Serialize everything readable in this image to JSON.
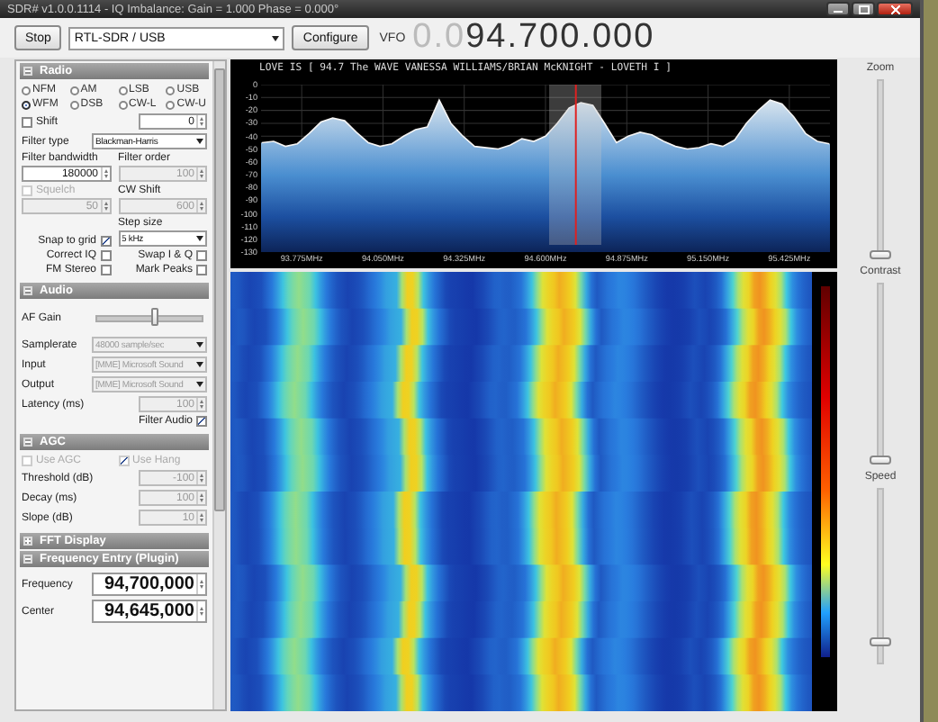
{
  "window": {
    "title": "SDR# v1.0.0.1114 - IQ Imbalance: Gain = 1.000 Phase = 0.000°"
  },
  "toolbar": {
    "stop_button": "Stop",
    "device": "RTL-SDR / USB",
    "configure_button": "Configure",
    "vfo_label": "VFO",
    "frequency_dim": "0.0",
    "frequency": "94.700.000"
  },
  "sidebar": {
    "sections": [
      {
        "title": "Radio",
        "expanded": true,
        "rows": [
          {
            "kind": "grid",
            "cells": [
              {
                "kind": "radio",
                "label": "NFM",
                "selected": false
              },
              {
                "kind": "radio",
                "label": "AM",
                "selected": false
              },
              {
                "kind": "radio",
                "label": "LSB",
                "selected": false
              },
              {
                "kind": "radio",
                "label": "USB",
                "selected": false
              }
            ]
          },
          {
            "kind": "grid",
            "cells": [
              {
                "kind": "radio",
                "label": "WFM",
                "selected": true
              },
              {
                "kind": "radio",
                "label": "DSB",
                "selected": false
              },
              {
                "kind": "radio",
                "label": "CW-L",
                "selected": false
              },
              {
                "kind": "radio",
                "label": "CW-U",
                "selected": false
              }
            ]
          },
          {
            "kind": "pair",
            "cells": [
              {
                "kind": "check",
                "label": "Shift",
                "checked": false,
                "disabled": false
              },
              {
                "kind": "spin",
                "value": "0",
                "disabled": false
              }
            ]
          },
          {
            "kind": "pair",
            "cells": [
              {
                "kind": "label",
                "text": "Filter type"
              },
              {
                "kind": "select",
                "value": "Blackman-Harris",
                "disabled": false
              }
            ]
          },
          {
            "kind": "grid",
            "cells": [
              {
                "kind": "spin",
                "value": "180000",
                "disabled": false,
                "over": {
                  "kind": "label",
                  "text": "Filter bandwidth"
                }
              },
              {
                "kind": "spin",
                "value": "100",
                "disabled": true,
                "over": {
                  "kind": "label",
                  "text": "Filter order"
                }
              }
            ]
          },
          {
            "kind": "grid",
            "cells": [
              {
                "kind": "spin",
                "value": "50",
                "disabled": true,
                "over": {
                  "kind": "check",
                  "label": "Squelch",
                  "checked": false,
                  "disabled": true
                }
              },
              {
                "kind": "spin",
                "value": "600",
                "disabled": true,
                "over": {
                  "kind": "label",
                  "text": "CW Shift"
                }
              }
            ]
          },
          {
            "kind": "grid",
            "cells": [
              {
                "kind": "labelled-check",
                "label": "Snap to grid",
                "checked": true,
                "disabled": false
              },
              {
                "kind": "select",
                "value": "5 kHz",
                "disabled": false,
                "over": {
                  "kind": "label",
                  "text": "Step size"
                }
              }
            ]
          },
          {
            "kind": "grid",
            "cells": [
              {
                "kind": "labelled-check",
                "label": "Correct IQ",
                "checked": false,
                "disabled": false
              },
              {
                "kind": "labelled-check",
                "label": "Swap I & Q",
                "checked": false,
                "disabled": false
              }
            ]
          },
          {
            "kind": "grid",
            "cells": [
              {
                "kind": "labelled-check",
                "label": "FM Stereo",
                "checked": false,
                "disabled": false
              },
              {
                "kind": "labelled-check",
                "label": "Mark Peaks",
                "checked": false,
                "disabled": false
              }
            ]
          }
        ]
      },
      {
        "title": "Audio",
        "expanded": true,
        "rows": [
          {
            "kind": "pair",
            "cells": [
              {
                "kind": "label",
                "text": "AF Gain"
              },
              {
                "kind": "slider",
                "level": 0.55
              }
            ]
          },
          {
            "kind": "pair",
            "cells": [
              {
                "kind": "label",
                "text": "Samplerate"
              },
              {
                "kind": "select",
                "value": "48000 sample/sec",
                "disabled": true
              }
            ]
          },
          {
            "kind": "pair",
            "cells": [
              {
                "kind": "label",
                "text": "Input"
              },
              {
                "kind": "select",
                "value": "[MME] Microsoft Sound",
                "disabled": true
              }
            ]
          },
          {
            "kind": "pair",
            "cells": [
              {
                "kind": "label",
                "text": "Output"
              },
              {
                "kind": "select",
                "value": "[MME] Microsoft Sound",
                "disabled": true
              }
            ]
          },
          {
            "kind": "pair",
            "cells": [
              {
                "kind": "label",
                "text": "Latency (ms)"
              },
              {
                "kind": "spin",
                "value": "100",
                "disabled": true
              }
            ]
          },
          {
            "kind": "grid",
            "cells": [
              "",
              {
                "kind": "labelled-check",
                "label": "Filter Audio",
                "checked": true,
                "disabled": false
              }
            ]
          }
        ]
      },
      {
        "title": "AGC",
        "expanded": true,
        "rows": [
          {
            "kind": "grid",
            "cells": [
              {
                "kind": "check",
                "label": "Use AGC",
                "checked": false,
                "disabled": true
              },
              {
                "kind": "check",
                "label": "Use Hang",
                "checked": true,
                "disabled": true
              }
            ]
          },
          {
            "kind": "pair",
            "cells": [
              {
                "kind": "label",
                "text": "Threshold (dB)"
              },
              {
                "kind": "spin",
                "value": "-100",
                "disabled": true
              }
            ]
          },
          {
            "kind": "pair",
            "cells": [
              {
                "kind": "label",
                "text": "Decay (ms)"
              },
              {
                "kind": "spin",
                "value": "100",
                "disabled": true
              }
            ]
          },
          {
            "kind": "pair",
            "cells": [
              {
                "kind": "label",
                "text": "Slope (dB)"
              },
              {
                "kind": "spin",
                "value": "10",
                "disabled": true
              }
            ]
          }
        ]
      },
      {
        "title": "FFT Display",
        "expanded": false
      },
      {
        "title": "Frequency Entry (Plugin)",
        "expanded": true,
        "rows": [
          {
            "kind": "pair",
            "cells": [
              {
                "kind": "label",
                "text": "Frequency"
              },
              {
                "kind": "big-spin",
                "value": "94,700,000",
                "disabled": false
              }
            ]
          },
          {
            "kind": "pair",
            "cells": [
              {
                "kind": "label",
                "text": "Center"
              },
              {
                "kind": "big-spin",
                "value": "94,645,000",
                "disabled": false
              }
            ]
          }
        ]
      }
    ]
  },
  "spectrum": {
    "station_text": "LOVE IS  [ 94.7 The WAVE VANESSA WILLIAMS/BRIAN McKNIGHT - LOVETH I ]",
    "chart_data": {
      "type": "area",
      "grid": true,
      "xlim": [
        93.6375,
        95.5625
      ],
      "ylim": [
        -130,
        0
      ],
      "xticks": [
        {
          "value": 93.775,
          "label": "93.775MHz"
        },
        {
          "value": 94.05,
          "label": "94.050MHz"
        },
        {
          "value": 94.325,
          "label": "94.325MHz"
        },
        {
          "value": 94.6,
          "label": "94.600MHz"
        },
        {
          "value": 94.875,
          "label": "94.875MHz"
        },
        {
          "value": 95.15,
          "label": "95.150MHz"
        },
        {
          "value": 95.425,
          "label": "95.425MHz"
        }
      ],
      "yticks": [
        0,
        -10,
        -20,
        -30,
        -40,
        -50,
        -60,
        -70,
        -80,
        -90,
        -100,
        -110,
        -120,
        -130
      ],
      "x": [
        93.64,
        93.68,
        93.72,
        93.76,
        93.8,
        93.84,
        93.88,
        93.92,
        93.96,
        94,
        94.04,
        94.08,
        94.12,
        94.16,
        94.2,
        94.24,
        94.28,
        94.32,
        94.36,
        94.4,
        94.44,
        94.48,
        94.52,
        94.56,
        94.6,
        94.64,
        94.68,
        94.72,
        94.76,
        94.8,
        94.84,
        94.88,
        94.92,
        94.96,
        95,
        95.04,
        95.08,
        95.12,
        95.16,
        95.2,
        95.24,
        95.28,
        95.32,
        95.36,
        95.4,
        95.44,
        95.48,
        95.52,
        95.56
      ],
      "series": [
        {
          "color": "#f4f4f4",
          "values": [
            -45,
            -44,
            -48,
            -46,
            -38,
            -29,
            -26,
            -28,
            -37,
            -45,
            -48,
            -46,
            -40,
            -35,
            -33,
            -12,
            -30,
            -40,
            -48,
            -49,
            -50,
            -47,
            -42,
            -44,
            -40,
            -30,
            -18,
            -14,
            -16,
            -30,
            -45,
            -40,
            -37,
            -39,
            -44,
            -48,
            -50,
            -49,
            -46,
            -48,
            -43,
            -30,
            -20,
            -12,
            -15,
            -25,
            -38,
            -44,
            -46
          ]
        }
      ]
    }
  },
  "sliders": [
    {
      "label": "Zoom",
      "level": 0
    },
    {
      "label": "Contrast",
      "level": 0
    },
    {
      "label": "Speed",
      "level": 0.12
    }
  ]
}
